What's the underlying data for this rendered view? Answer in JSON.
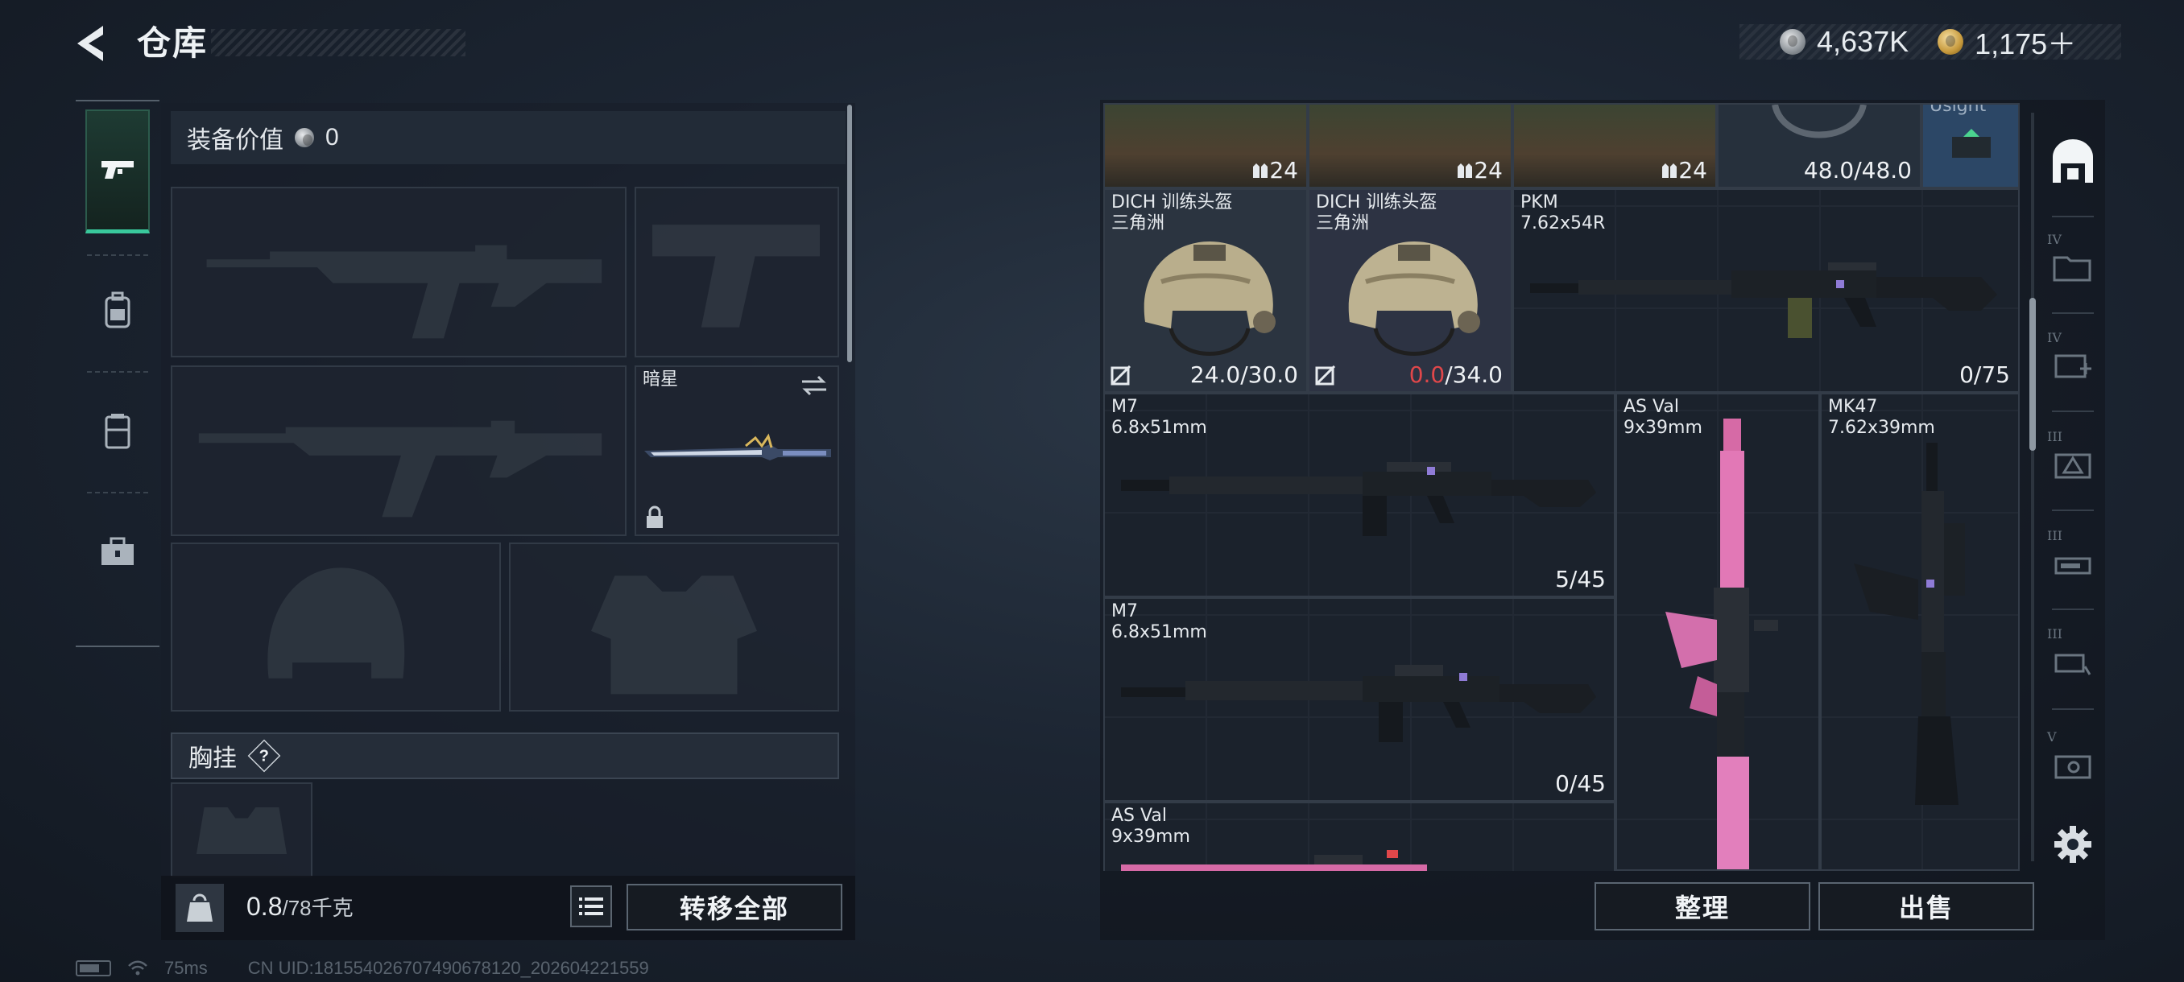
{
  "header": {
    "title": "仓库",
    "currency": [
      {
        "icon": "silver-coin-icon",
        "value": "4,637K"
      },
      {
        "icon": "gold-coin-icon",
        "value": "1,175＋"
      }
    ]
  },
  "rail": {
    "items": [
      {
        "icon": "pistol-icon",
        "active": true
      },
      {
        "icon": "backpack-icon",
        "active": false
      },
      {
        "icon": "vest-icon",
        "active": false
      },
      {
        "icon": "briefcase-icon",
        "active": false
      }
    ]
  },
  "equipment": {
    "value_label": "装备价值",
    "value": "0",
    "melee": {
      "name": "暗星"
    },
    "chest_label": "胸挂",
    "help": "?"
  },
  "footer_left": {
    "weight": "0.8",
    "capacity": "/78千克",
    "transfer_all": "转移全部"
  },
  "stash": {
    "top_row": [
      {
        "count": "24"
      },
      {
        "count": "24"
      },
      {
        "count": "24"
      },
      {
        "count": "48.0/48.0"
      },
      {
        "name": "Usight"
      }
    ],
    "items": [
      {
        "id": "helmet1",
        "name": "DICH 训练头盔",
        "sub": "三角洲",
        "cur": "24.0",
        "max": "/30.0"
      },
      {
        "id": "helmet2",
        "name": "DICH 训练头盔",
        "sub": "三角洲",
        "cur": "0.0",
        "max": "/34.0"
      },
      {
        "id": "pkm",
        "name": "PKM",
        "sub": "7.62x54R",
        "count": "0/75"
      },
      {
        "id": "m7a",
        "name": "M7",
        "sub": "6.8x51mm",
        "count": "5/45"
      },
      {
        "id": "asval1",
        "name": "AS Val",
        "sub": "9x39mm"
      },
      {
        "id": "mk47",
        "name": "MK47",
        "sub": "7.62x39mm"
      },
      {
        "id": "m7b",
        "name": "M7",
        "sub": "6.8x51mm",
        "count": "0/45"
      },
      {
        "id": "asval2",
        "name": "AS Val",
        "sub": "9x39mm"
      }
    ],
    "tabs": [
      "IV",
      "IV",
      "III",
      "III",
      "III",
      "V"
    ],
    "sort_button": "整理",
    "sell_button": "出售"
  },
  "status": {
    "ping": "75ms",
    "uid": "CN UID:181554026707490678120_202604221559"
  },
  "colors": {
    "accent": "#39c89c",
    "warning": "#e0474a"
  }
}
